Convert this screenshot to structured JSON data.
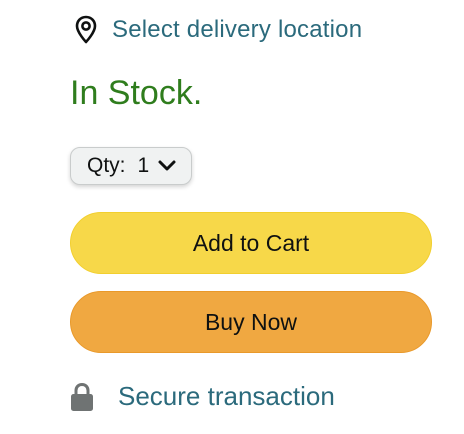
{
  "delivery": {
    "icon": "location-pin-icon",
    "label": "Select delivery location"
  },
  "availability": {
    "text": "In Stock.",
    "color": "#2f7d1d"
  },
  "quantity": {
    "label": "Qty:",
    "value": "1",
    "icon": "chevron-down-icon"
  },
  "buttons": {
    "add_to_cart": "Add to Cart",
    "buy_now": "Buy Now",
    "add_to_cart_color": "#f7d849",
    "buy_now_color": "#f0a841"
  },
  "secure": {
    "icon": "lock-icon",
    "label": "Secure transaction"
  },
  "colors": {
    "link": "#2b6a7c"
  }
}
